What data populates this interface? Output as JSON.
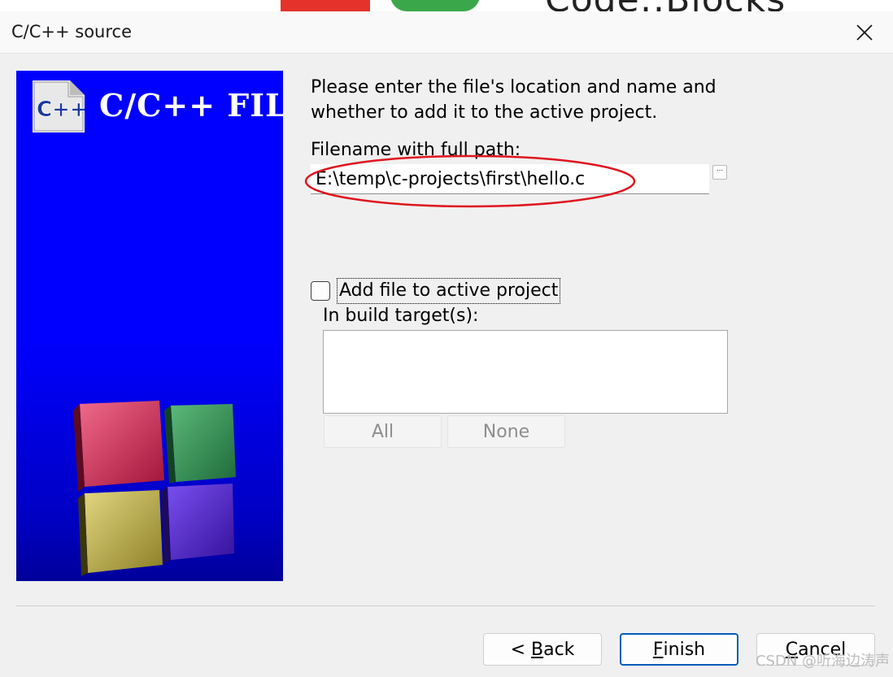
{
  "backdrop": {
    "text": "Code::Blocks"
  },
  "window": {
    "title": "C/C++ source"
  },
  "banner": {
    "logo_text": "C++",
    "title": "C/C++ FILE"
  },
  "content": {
    "intro": "Please enter the file's location and name and whether to add it to the active project.",
    "filename_label": "Filename with full path:",
    "filename_value": "E:\\temp\\c-projects\\first\\hello.c",
    "browse_label": "...",
    "add_to_project_label": "Add file to active project",
    "add_to_project_checked": false,
    "build_targets_label": "In build target(s):",
    "build_targets": [],
    "all_button": "All",
    "none_button": "None"
  },
  "footer": {
    "back_prefix": "< ",
    "back_key": "B",
    "back_rest": "ack",
    "finish_key": "F",
    "finish_rest": "inish",
    "cancel_key": "C",
    "cancel_rest": "ancel"
  },
  "watermark": "CSDN @听海边涛声",
  "colors": {
    "banner_blue": "#0000ff",
    "annotation_red": "#e0141e",
    "default_button_border": "#005fb8"
  }
}
